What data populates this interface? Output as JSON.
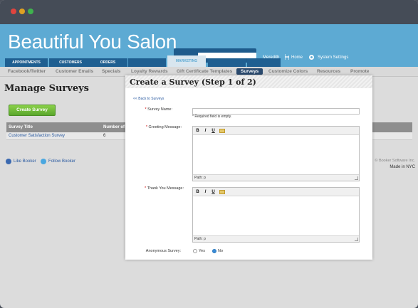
{
  "header": {
    "brand": "Beautiful You Salon",
    "user": "Meredith",
    "home": "Home",
    "settings": "System Settings"
  },
  "main_tabs": [
    {
      "label": "APPOINTMENTS"
    },
    {
      "label": "CUSTOMERS"
    },
    {
      "label": "ORDERS"
    },
    {
      "label": ""
    },
    {
      "label": "MARKETING"
    },
    {
      "label": ""
    },
    {
      "label": ""
    }
  ],
  "subnav": [
    "Facebook/Twitter",
    "Customer Emails",
    "Specials",
    "Loyalty Rewards",
    "Gift Certificate Templates",
    "Surveys",
    "Customize Colors",
    "Resources",
    "Promote"
  ],
  "page": {
    "title": "Manage Surveys",
    "create_button": "Create Survey",
    "table": {
      "headers": [
        "Survey Title",
        "Number of"
      ],
      "rows": [
        [
          "Customer Satisfaction Survey",
          "6"
        ]
      ]
    }
  },
  "footer": {
    "like": "Like Booker",
    "follow": "Follow Booker",
    "copyright": "© Booker Software Inc.",
    "made": "Made in NYC"
  },
  "modal": {
    "title": "Create a Survey (Step 1 of 2)",
    "back": "<< Back to Surveys",
    "name_label": "Survey Name:",
    "required_note": "* Required field is empty.",
    "greeting_label": "Greeting Message:",
    "thanks_label": "Thank You Message:",
    "path": "Path: p",
    "anon_label": "Anonymous Survey:",
    "yes": "Yes",
    "no": "No",
    "selected": "No"
  },
  "colors": {
    "header_bg": "#5daad3",
    "tab_bg": "#1f5f91",
    "accent_green": "#6cbf36"
  }
}
